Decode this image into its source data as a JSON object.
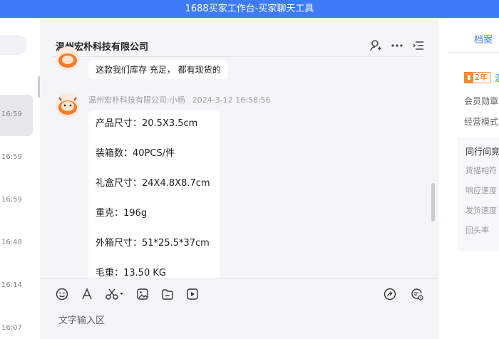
{
  "window": {
    "title": "1688买家工作台-买家聊天工具"
  },
  "conversation_list": {
    "items": [
      {
        "time": "16:59",
        "active": true
      },
      {
        "time": "16:59"
      },
      {
        "time": "16:59"
      },
      {
        "time": "16:48"
      },
      {
        "time": "16:14"
      },
      {
        "time": "16:07"
      }
    ]
  },
  "chat": {
    "title": "温州宏朴科技有限公司",
    "messages": [
      {
        "text": "这款我们库存 充足， 都有现货的"
      },
      {
        "sender": "温州宏朴科技有限公司:小杨",
        "time": "2024-3-12 16:58:56",
        "lines": [
          "产品尺寸：20.5X3.5cm",
          "装箱数：40PCS/件",
          "礼盒尺寸：24X4.8X8.7cm",
          "重克：196g",
          "外箱尺寸：51*25.5*37cm",
          "毛重：13.50 KG"
        ]
      }
    ],
    "input_placeholder": "文字输入区"
  },
  "profile_panel": {
    "tab_label": "档案",
    "badge_years": "2年",
    "badge_tail": "温",
    "labels": [
      "会员勋章",
      "经营模式"
    ],
    "peer_box": {
      "title": "同行间竞",
      "items": [
        "货描相符",
        "响应速度",
        "发货速度",
        "回头率"
      ]
    }
  },
  "colors": {
    "accent": "#3e7bfa",
    "badge": "#f28b2f"
  }
}
